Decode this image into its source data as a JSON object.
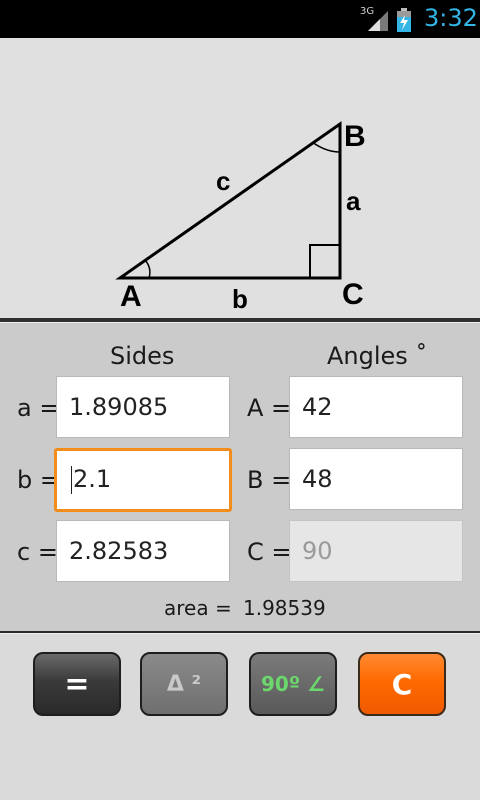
{
  "status_bar": {
    "network": "3G",
    "time": "3:32"
  },
  "diagram": {
    "vertex_a": "A",
    "vertex_b": "B",
    "vertex_c": "C",
    "side_a": "a",
    "side_b": "b",
    "side_c": "c"
  },
  "form": {
    "sides_header": "Sides",
    "angles_header": "Angles ˚",
    "rows": [
      {
        "side_label": "a =",
        "side_value": "1.89085",
        "angle_label": "A =",
        "angle_value": "42"
      },
      {
        "side_label": "b =",
        "side_value": "2.1",
        "angle_label": "B =",
        "angle_value": "48"
      },
      {
        "side_label": "c =",
        "side_value": "2.82583",
        "angle_label": "C =",
        "angle_value": "90"
      }
    ],
    "area_label": "area =",
    "area_value": "1.98539"
  },
  "buttons": {
    "equals": "=",
    "delta": "Δ ²",
    "right_angle": "90º ∠",
    "clear": "C"
  },
  "colors": {
    "focus_border": "#f28c1b",
    "clear_button": "#ff6a00",
    "clock": "#33b5e5",
    "right_angle_text": "#6cd86c"
  }
}
